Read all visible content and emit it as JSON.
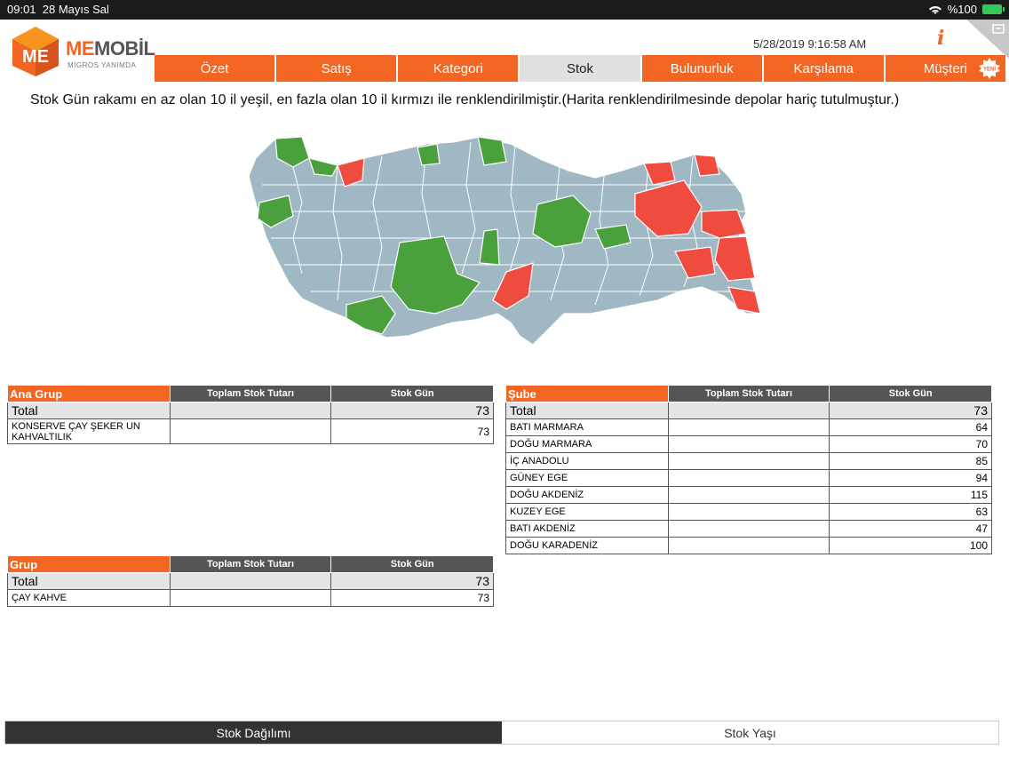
{
  "statusbar": {
    "time": "09:01",
    "date": "28 Mayıs Sal",
    "battery": "%100"
  },
  "header": {
    "logo_me": "ME",
    "logo_mobil": "MOBİL",
    "logo_sub": "MİGROS YANIMDA",
    "datetime": "5/28/2019 9:16:58 AM",
    "info_icon": "i"
  },
  "nav": {
    "tabs": [
      {
        "label": "Özet"
      },
      {
        "label": "Satış"
      },
      {
        "label": "Kategori"
      },
      {
        "label": "Stok",
        "active": true
      },
      {
        "label": "Bulunurluk"
      },
      {
        "label": "Karşılama"
      },
      {
        "label": "Müşteri",
        "badge": "YENİ"
      }
    ]
  },
  "notice": "Stok Gün rakamı en az olan 10 il yeşil, en fazla olan 10 il kırmızı ile renklendirilmiştir.(Harita renklendirilmesinde depolar hariç tutulmuştur.)",
  "map_colors": {
    "default": "#9fb8c3",
    "green": "#4aa03c",
    "red": "#f04b3f",
    "border": "#ffffff"
  },
  "ana_grup": {
    "headers": [
      "Ana Grup",
      "Toplam Stok Tutarı",
      "Stok Gün"
    ],
    "total": {
      "label": "Total",
      "tutar": "",
      "gun": "73"
    },
    "rows": [
      {
        "label": "KONSERVE ÇAY ŞEKER UN KAHVALTILIK",
        "tutar": "",
        "gun": "73"
      }
    ]
  },
  "grup": {
    "headers": [
      "Grup",
      "Toplam Stok Tutarı",
      "Stok Gün"
    ],
    "total": {
      "label": "Total",
      "tutar": "",
      "gun": "73"
    },
    "rows": [
      {
        "label": "ÇAY KAHVE",
        "tutar": "",
        "gun": "73"
      }
    ]
  },
  "sube": {
    "headers": [
      "Şube",
      "Toplam Stok Tutarı",
      "Stok Gün"
    ],
    "total": {
      "label": "Total",
      "tutar": "",
      "gun": "73"
    },
    "rows": [
      {
        "label": "BATI MARMARA",
        "tutar": "",
        "gun": "64"
      },
      {
        "label": "DOĞU MARMARA",
        "tutar": "",
        "gun": "70"
      },
      {
        "label": "İÇ ANADOLU",
        "tutar": "",
        "gun": "85"
      },
      {
        "label": "GÜNEY EGE",
        "tutar": "",
        "gun": "94"
      },
      {
        "label": "DOĞU AKDENİZ",
        "tutar": "",
        "gun": "115"
      },
      {
        "label": "KUZEY EGE",
        "tutar": "",
        "gun": "63"
      },
      {
        "label": "BATI AKDENİZ",
        "tutar": "",
        "gun": "47"
      },
      {
        "label": "DOĞU KARADENİZ",
        "tutar": "",
        "gun": "100"
      }
    ]
  },
  "bottom_tabs": [
    {
      "label": "Stok Dağılımı",
      "active": true
    },
    {
      "label": "Stok Yaşı",
      "active": false
    }
  ]
}
